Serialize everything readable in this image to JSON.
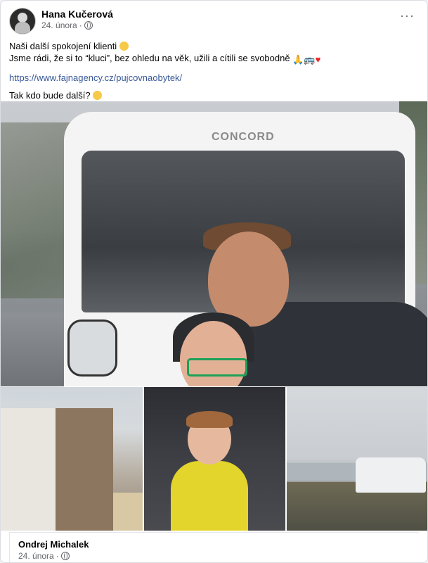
{
  "post": {
    "author": "Hana Kučerová",
    "date": "24. února",
    "dot": "·",
    "more": "···",
    "line1": "Naši další spokojení klienti",
    "line2": "Jsme rádi, že si to “kluci”, bez ohledu na věk, užili a cítili se svobodně",
    "link": "https://www.fajnagency.cz/pujcovnaobytek/",
    "line3": "Tak kdo bude další?",
    "rv_brand": "CONCORD"
  },
  "shared": {
    "author": "Ondrej Michalek",
    "date": "24. února",
    "dot": "·"
  },
  "colors": {
    "link": "#385898",
    "text": "#050505",
    "meta": "#65676b"
  }
}
